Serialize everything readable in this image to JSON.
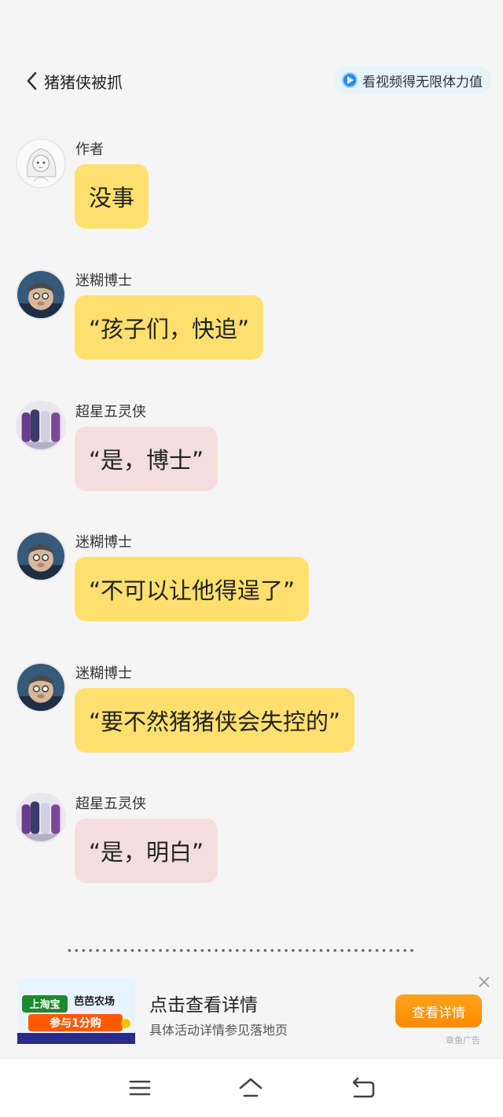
{
  "header": {
    "back_icon": "chevron-left-icon",
    "title": "猪猪侠被抓",
    "video_icon": "play-icon",
    "video_label": "看视频得无限体力值"
  },
  "messages": [
    {
      "sender": "作者",
      "text": "没事",
      "bubble": "yellow",
      "avatar": "author-avatar"
    },
    {
      "sender": "迷糊博士",
      "text": "“孩子们，快追”",
      "bubble": "yellow",
      "avatar": "doctor-avatar"
    },
    {
      "sender": "超星五灵侠",
      "text": "“是，博士”",
      "bubble": "pink",
      "avatar": "heroes-avatar"
    },
    {
      "sender": "迷糊博士",
      "text": "“不可以让他得逞了”",
      "bubble": "yellow",
      "avatar": "doctor-avatar"
    },
    {
      "sender": "迷糊博士",
      "text": "“要不然猪猪侠会失控的”",
      "bubble": "yellow",
      "avatar": "doctor-avatar"
    },
    {
      "sender": "超星五灵侠",
      "text": "“是，明白”",
      "bubble": "pink",
      "avatar": "heroes-avatar"
    }
  ],
  "ad": {
    "image_text_1": "上淘宝",
    "image_text_2": "芭芭农场",
    "image_text_3": "参与1分购",
    "title": "点击查看详情",
    "description": "具体活动详情参见落地页",
    "button_label": "查看详情",
    "tag": "章鱼广告",
    "close_icon": "close-icon"
  },
  "navbar": {
    "menu_icon": "menu-icon",
    "home_icon": "home-icon",
    "back_icon": "back-icon"
  },
  "colors": {
    "yellow_bubble": "#ffe06e",
    "pink_bubble": "#f3dede",
    "ad_button": "#ff8a00",
    "video_icon": "#1f8ef1"
  }
}
